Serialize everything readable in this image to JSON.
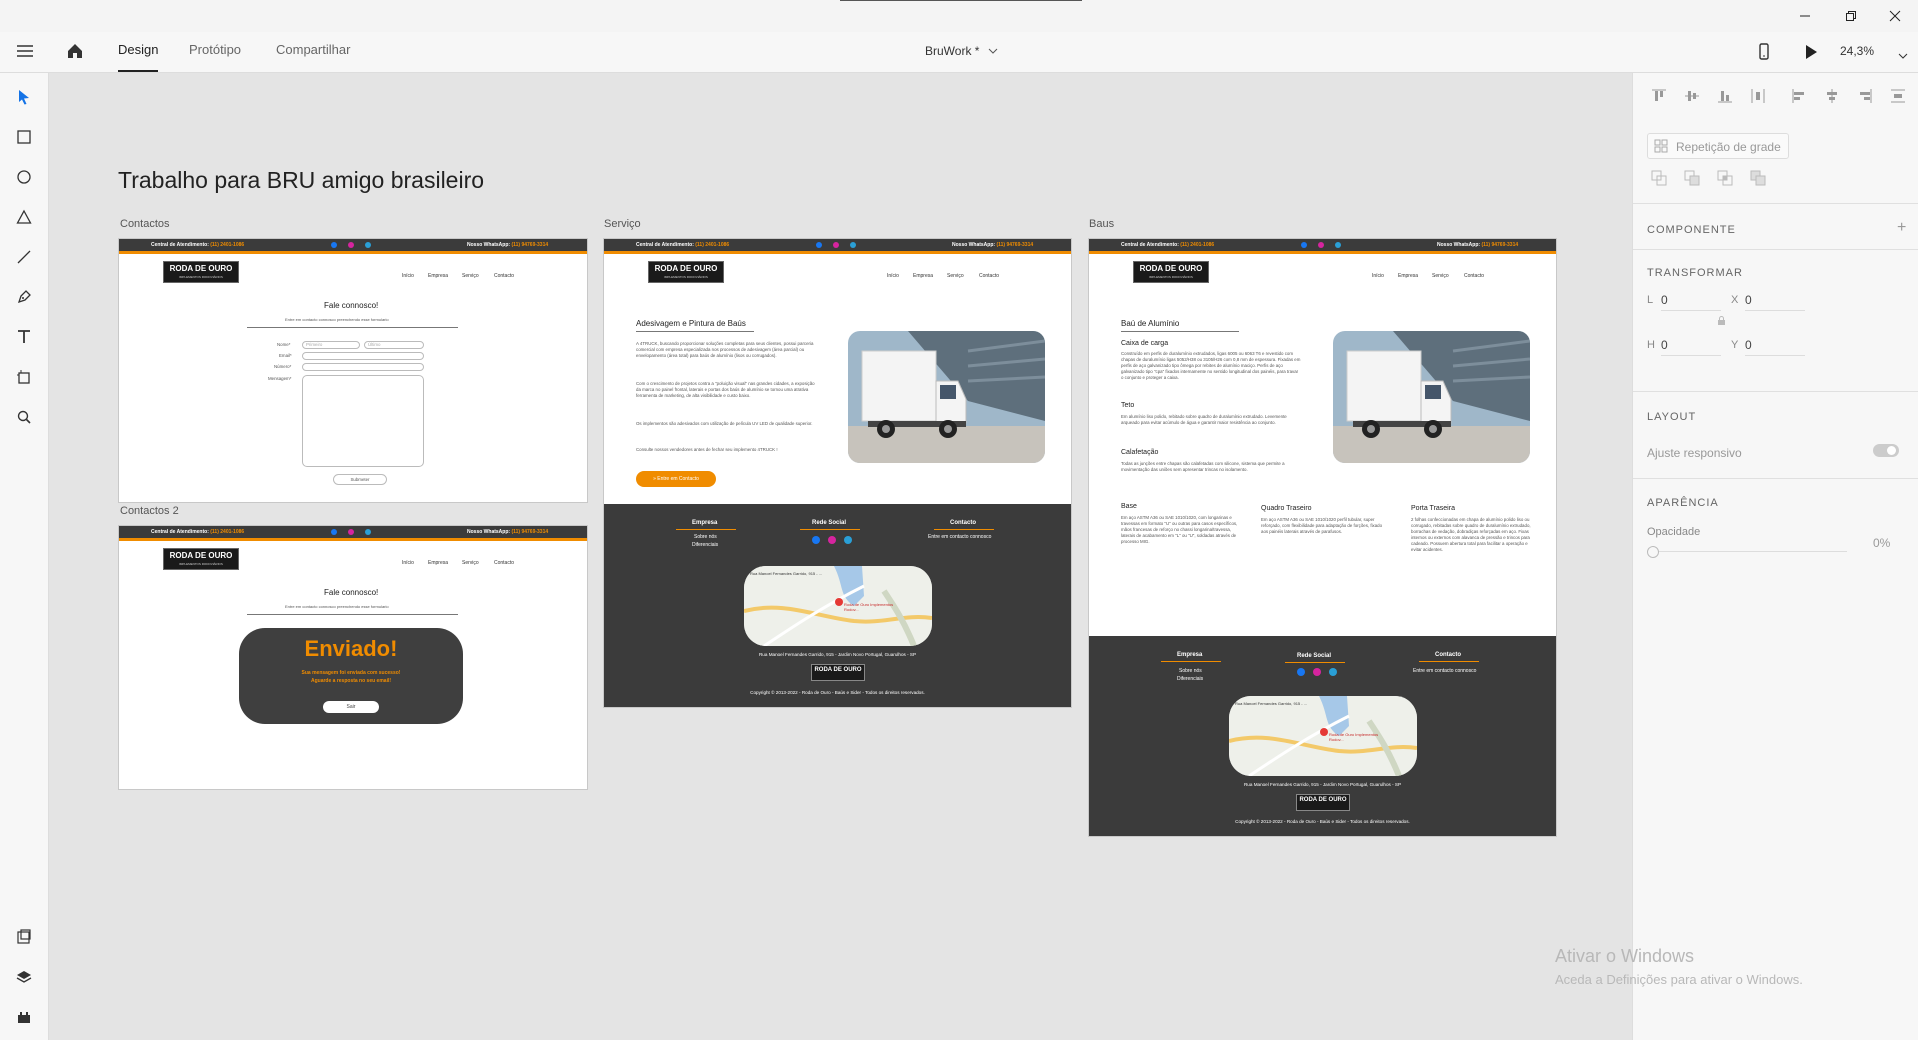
{
  "window": {
    "minimize_icon": "minimize-icon",
    "restore_icon": "restore-icon",
    "close_icon": "close-icon"
  },
  "toolbar": {
    "tabs": [
      {
        "label": "Design"
      },
      {
        "label": "Protótipo"
      },
      {
        "label": "Compartilhar"
      }
    ],
    "doc_title": "BruWork *",
    "zoom": "24,3%"
  },
  "canvas": {
    "heading": "Trabalho para BRU amigo brasileiro",
    "artboards": {
      "contactos": "Contactos",
      "servico": "Serviço",
      "baus": "Baus",
      "contactos2": "Contactos 2"
    }
  },
  "site": {
    "topbar": {
      "central_label": "Central de Atendimento:",
      "central_phone": "(11) 2401-1086",
      "whatsapp_label": "Nosso WhatsApp:",
      "whatsapp_phone": "(11) 94769-3314"
    },
    "logo": "RODA DE OURO",
    "logo_sub": "IMPLEMENTOS RODOVIÁRIOS",
    "nav": [
      "Início",
      "Empresa",
      "Serviço",
      "Contacto"
    ],
    "contact": {
      "title": "Fale connosco!",
      "subtitle": "Entre em contacto connosco preenchendo esse formulario",
      "name_label": "Nome*",
      "first_placeholder": "Primeiro",
      "last_placeholder": "Último",
      "email_label": "Email*",
      "phone_label": "Número*",
      "message_label": "Mensagem*",
      "submit": "Submeter"
    },
    "sent": {
      "title": "Enviado!",
      "line1": "Sua mensagem foi enviada com sucesso!",
      "line2": "Aguarde a resposta no seu email!",
      "button": "Sair"
    },
    "servico": {
      "title": "Adesivagem e Pintura de Baús",
      "p1": "A 4TRUCK, buscando proporcionar soluções completas para seus clientes, possui parceria comercial com empresa especializada nos processos de adesivagem (área parcial) ou envelopamento (área total) para baús de alumínio (lisos ou corrugados).",
      "p2": "Com o crescimento de projetos contra a \"poluição visual\" nas grandes cidades, a exposição da marca no painel frontal, laterais e portas dos baús de alumínio se tornou uma atrativa ferramenta de marketing, de alta visibilidade e custo baixo.",
      "p3": "Os implementos são adesivados com utilização de película UV LED de qualidade superior.",
      "p4": "Consulte nossos vendedores antes de fechar seu implemento 4TRUCK !",
      "cta": "» Entre em Contacto"
    },
    "baus": {
      "title": "Baú de Alumínio",
      "caixa_title": "Caixa de carga",
      "caixa_text": "Construído em perfis de duralumínio extrudados, ligas 6005 ou 6063 T6 e revestido com chapas de duralumínio ligas 5052/H38 ou 3105/H26 com 0,8 mm de espessura. Fixadas em perfis de aço galvanizado tipo ômega por rebites de alumínio maciço. Perfis de aço galvanizado tipo \"cpa\" fixados internamente no sentido longitudinal dos painéis, para travar o conjunto e proteger a caixa.",
      "teto_title": "Teto",
      "teto_text": "Em alumínio liso polido, rebitado sobre quadro de duralumínio extrudado. Levemente arqueado para evitar acúmulo de água e garantir maior resistência ao conjunto.",
      "calaf_title": "Calafetação",
      "calaf_text": "Todas as junções entre chapas são calafetadas com silicone, sistema que permite a movimentação das uniões sem apresentar trincas no isolamento.",
      "base_title": "Base",
      "base_text": "Em aço ASTM A36 ou SAE 1010/1020, com longarinas e travessas em formato \"U\" ou outras para casos específicos, mãos francesas de reforço no chassi longarina/travessa, laterais de acabamento em \"L\" ou \"U\", soldadas através de processo MIG.",
      "quadro_title": "Quadro Traseiro",
      "quadro_text": "Em aço ASTM A36 ou SAE 1010/1020 perfil tubular, super reforçado, com flexibilidade para adaptação de forções, fixado aos painéis laterais através de parafusos.",
      "porta_title": "Porta Traseira",
      "porta_text": "2 folhas confeccionadas em chapa de alumínio polido liso ou corrugado, rebitadas sobre quadro de duralumínio extrudado, borrachas de vedação, dobradiças reforçadas em aço. Fixas internos ou externos com alavanca de pressão e trincos para cadeado. Possuem abertura total para facilitar a operação e evitar acidentes."
    },
    "footer": {
      "empresa": "Empresa",
      "empresa_links": [
        "Sobre nós",
        "Diferenciais"
      ],
      "rede": "Rede Social",
      "contacto": "Contacto",
      "contacto_link": "Entre em contacto connosco",
      "map_place": "Rua Manoel Fernandes Garrido, 915 - ...",
      "map_pin": "Roda de Ouro Implementos Rodov...",
      "address": "Rua Manoel Fernandes Garrido, 915 - Jardim Novo Portugal, Guarulhos - SP",
      "copyright": "Copyright © 2013-2022 - Roda de Ouro - Baús e Sider - Todos os direitos reservados."
    }
  },
  "panel": {
    "grid_repeat": "Repetição de grade",
    "componente": "COMPONENTE",
    "transformar": "TRANSFORMAR",
    "w_label": "L",
    "w_value": "0",
    "x_label": "X",
    "x_value": "0",
    "h_label": "H",
    "h_value": "0",
    "y_label": "Y",
    "y_value": "0",
    "layout": "LAYOUT",
    "responsive": "Ajuste responsivo",
    "aparencia": "APARÊNCIA",
    "opacity_label": "Opacidade",
    "opacity_value": "0%"
  },
  "watermark": {
    "title": "Ativar o Windows",
    "subtitle": "Aceda a Definições para ativar o Windows."
  },
  "colors": {
    "accent": "#f08c00",
    "dark": "#3b3b3b",
    "facebook": "#1877f2",
    "instagram": "#d6249f",
    "linkedin": "#2a9fd6"
  }
}
